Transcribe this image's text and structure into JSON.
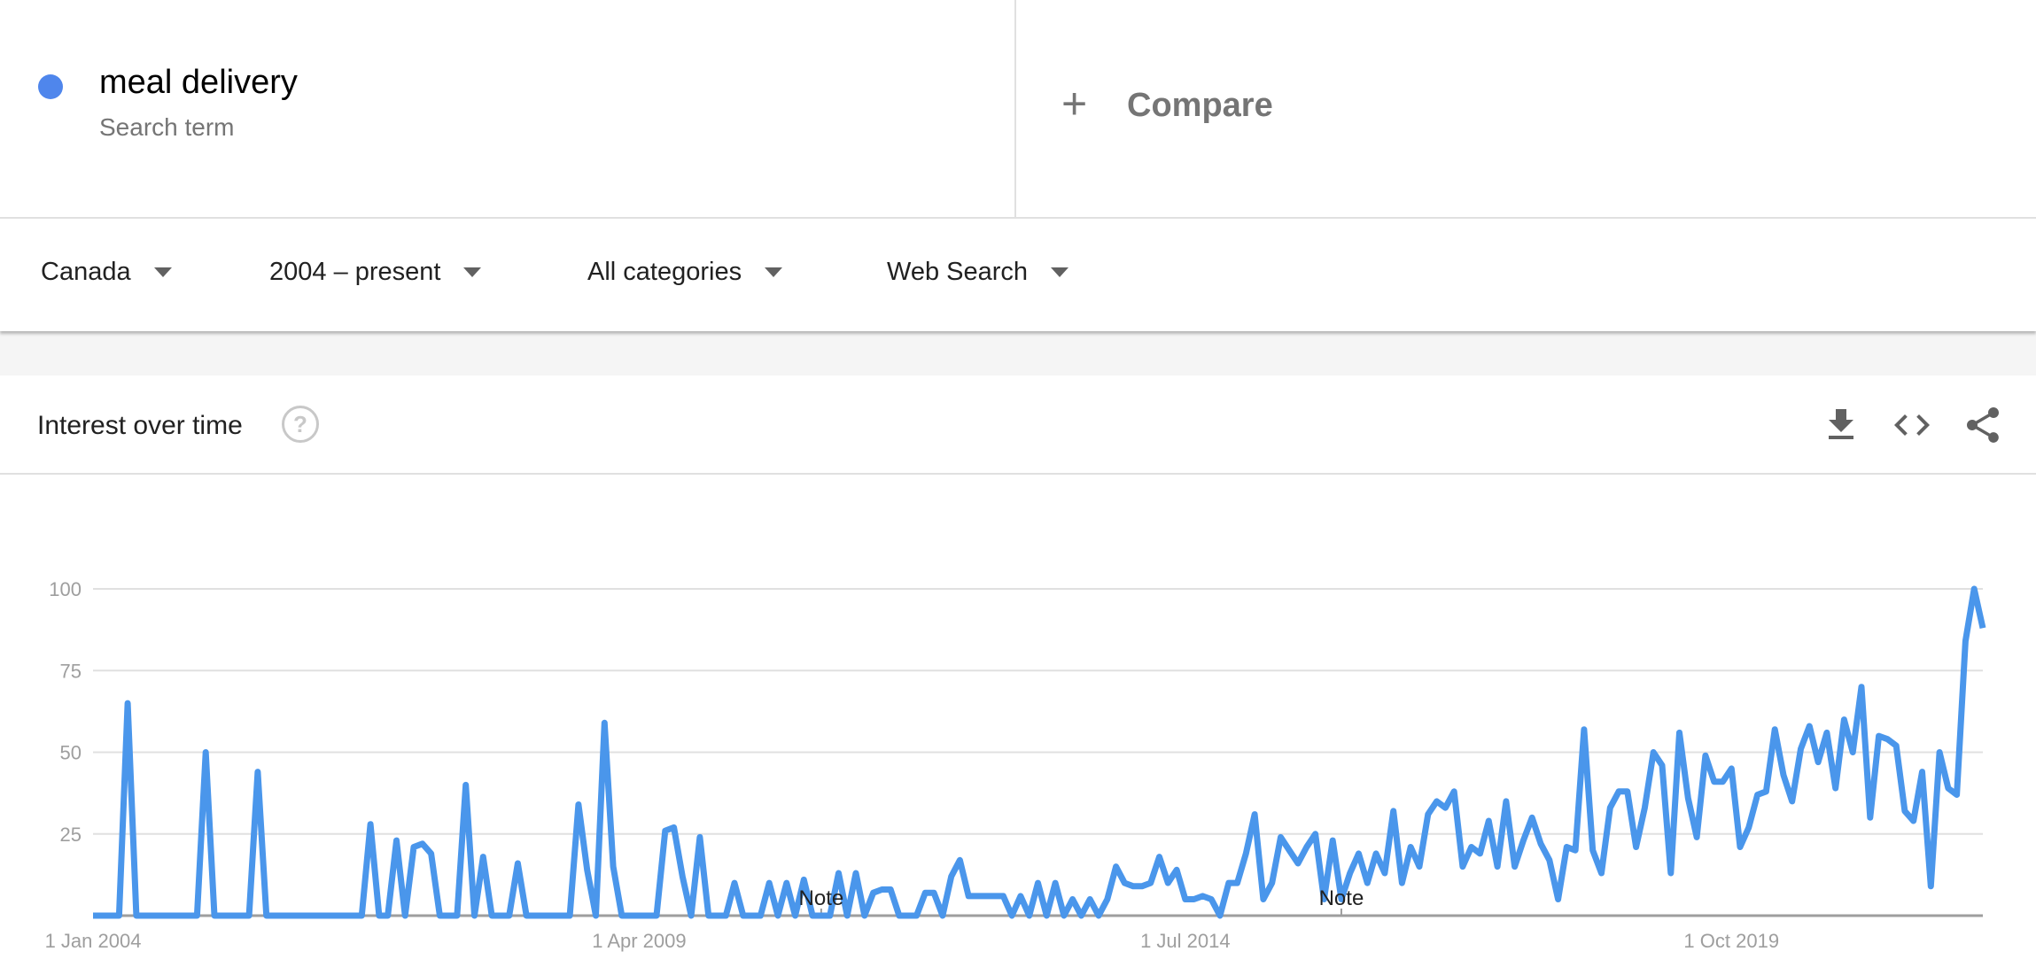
{
  "search_term": {
    "name": "meal delivery",
    "subtitle": "Search term",
    "color": "#4f86ec"
  },
  "compare": {
    "icon": "plus-icon",
    "label": "Compare"
  },
  "filters": [
    {
      "label": "Canada",
      "icon": "caret-down-icon"
    },
    {
      "label": "2004 – present",
      "icon": "caret-down-icon"
    },
    {
      "label": "All categories",
      "icon": "caret-down-icon"
    },
    {
      "label": "Web Search",
      "icon": "caret-down-icon"
    }
  ],
  "interest_panel": {
    "title": "Interest over time",
    "help_icon": "help-icon",
    "actions": [
      "download-icon",
      "embed-code-icon",
      "share-icon"
    ]
  },
  "chart_data": {
    "type": "line",
    "title": "Interest over time",
    "xlabel": "",
    "ylabel": "",
    "ylim": [
      0,
      100
    ],
    "yticks": [
      25,
      50,
      75,
      100
    ],
    "xtick_labels": [
      "1 Jan 2004",
      "1 Apr 2009",
      "1 Jul 2014",
      "1 Oct 2019"
    ],
    "xtick_positions": [
      0,
      63,
      126,
      189
    ],
    "grid": true,
    "legend": "none",
    "line_color": "#4a96eb",
    "annotations": [
      {
        "label": "Note",
        "index": 84
      },
      {
        "label": "Note",
        "index": 144
      }
    ],
    "series": [
      {
        "name": "meal delivery",
        "values": [
          0,
          0,
          0,
          0,
          65,
          0,
          0,
          0,
          0,
          0,
          0,
          0,
          0,
          50,
          0,
          0,
          0,
          0,
          0,
          44,
          0,
          0,
          0,
          0,
          0,
          0,
          0,
          0,
          0,
          0,
          0,
          0,
          28,
          0,
          0,
          23,
          0,
          21,
          22,
          19,
          0,
          0,
          0,
          40,
          0,
          18,
          0,
          0,
          0,
          16,
          0,
          0,
          0,
          0,
          0,
          0,
          34,
          14,
          0,
          59,
          15,
          0,
          0,
          0,
          0,
          0,
          26,
          27,
          12,
          0,
          24,
          0,
          0,
          0,
          10,
          0,
          0,
          0,
          10,
          0,
          10,
          0,
          11,
          0,
          0,
          0,
          13,
          0,
          13,
          0,
          7,
          8,
          8,
          0,
          0,
          0,
          7,
          7,
          0,
          12,
          17,
          6,
          6,
          6,
          6,
          6,
          0,
          6,
          0,
          10,
          0,
          10,
          0,
          5,
          0,
          5,
          0,
          5,
          15,
          10,
          9,
          9,
          10,
          18,
          10,
          14,
          5,
          5,
          6,
          5,
          0,
          10,
          10,
          19,
          31,
          5,
          10,
          24,
          20,
          16,
          21,
          25,
          5,
          23,
          5,
          13,
          19,
          10,
          19,
          13,
          32,
          10,
          21,
          15,
          31,
          35,
          33,
          38,
          15,
          21,
          19,
          29,
          15,
          35,
          15,
          23,
          30,
          22,
          17,
          5,
          21,
          20,
          57,
          20,
          13,
          33,
          38,
          38,
          21,
          33,
          50,
          46,
          13,
          56,
          36,
          24,
          49,
          41,
          41,
          45,
          21,
          27,
          37,
          38,
          57,
          43,
          35,
          51,
          58,
          47,
          56,
          39,
          60,
          50,
          70,
          30,
          55,
          54,
          52,
          32,
          29,
          44,
          9,
          50,
          39,
          37,
          84,
          100,
          88
        ]
      }
    ]
  }
}
